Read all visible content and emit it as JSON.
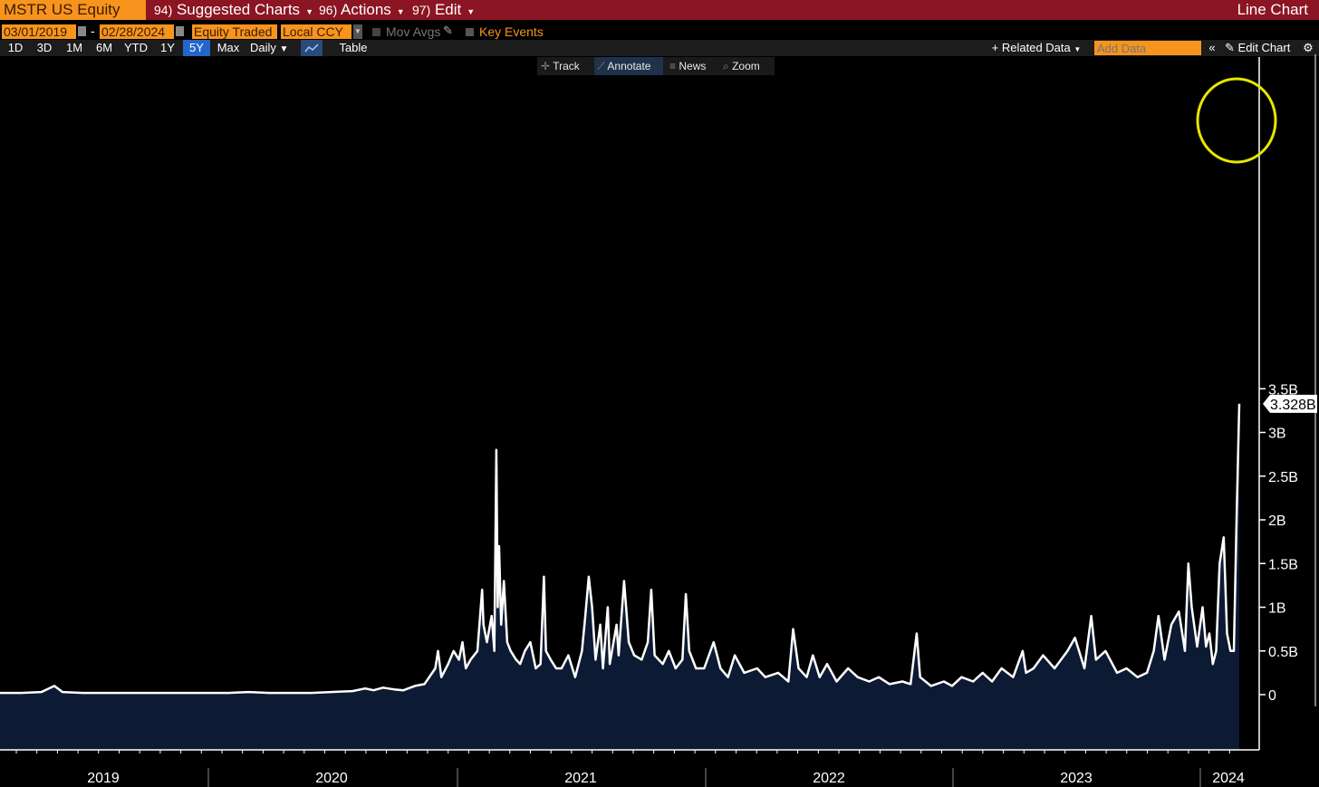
{
  "toolbar": {
    "ticker": "MSTR US Equity",
    "menu": [
      {
        "num": "94)",
        "label": "Suggested Charts"
      },
      {
        "num": "96)",
        "label": "Actions"
      },
      {
        "num": "97)",
        "label": "Edit"
      }
    ],
    "chart_kind": "Line Chart"
  },
  "range": {
    "start": "03/01/2019",
    "end": "02/28/2024",
    "field": "Equity Traded",
    "currency": "Local CCY",
    "mov_avgs": "Mov Avgs",
    "key_events": "Key Events"
  },
  "periods": [
    "1D",
    "3D",
    "1M",
    "6M",
    "YTD",
    "1Y",
    "5Y",
    "Max"
  ],
  "active_period": "5Y",
  "frequency": "Daily",
  "table_label": "Table",
  "related_data": "+ Related Data",
  "add_data_placeholder": "Add Data",
  "edit_chart": "Edit Chart",
  "annotations": [
    "Track",
    "Annotate",
    "News",
    "Zoom"
  ],
  "colors": {
    "line": "#ffffff",
    "fill": "#0c1a33",
    "highlight_circle": "#e6e600",
    "toolbar": "#8b1522",
    "accent": "#f7941d"
  },
  "chart_data": {
    "type": "area",
    "series": [
      {
        "name": "Equity Traded",
        "last_value_label": "3.328B"
      }
    ],
    "x_ticks": [
      "2019",
      "2020",
      "2021",
      "2022",
      "2023",
      "2024"
    ],
    "y_ticks": [
      "3.5B",
      "3B",
      "2.5B",
      "2B",
      "1.5B",
      "1B",
      "0.5B",
      "0"
    ],
    "ylim": [
      0,
      3500000000
    ],
    "x_start": "2019-03-01",
    "x_end": "2024-02-28",
    "points": [
      [
        "2019-03-01",
        0.02
      ],
      [
        "2019-04-01",
        0.02
      ],
      [
        "2019-05-01",
        0.03
      ],
      [
        "2019-05-20",
        0.1
      ],
      [
        "2019-06-01",
        0.03
      ],
      [
        "2019-07-01",
        0.02
      ],
      [
        "2019-08-01",
        0.02
      ],
      [
        "2019-09-01",
        0.02
      ],
      [
        "2019-10-01",
        0.02
      ],
      [
        "2019-11-01",
        0.02
      ],
      [
        "2019-12-01",
        0.02
      ],
      [
        "2020-01-01",
        0.02
      ],
      [
        "2020-02-01",
        0.02
      ],
      [
        "2020-03-01",
        0.03
      ],
      [
        "2020-04-01",
        0.02
      ],
      [
        "2020-05-01",
        0.02
      ],
      [
        "2020-06-01",
        0.02
      ],
      [
        "2020-07-01",
        0.03
      ],
      [
        "2020-08-01",
        0.04
      ],
      [
        "2020-08-20",
        0.07
      ],
      [
        "2020-09-01",
        0.05
      ],
      [
        "2020-09-15",
        0.08
      ],
      [
        "2020-10-01",
        0.06
      ],
      [
        "2020-10-15",
        0.05
      ],
      [
        "2020-11-01",
        0.1
      ],
      [
        "2020-11-15",
        0.12
      ],
      [
        "2020-12-01",
        0.3
      ],
      [
        "2020-12-05",
        0.5
      ],
      [
        "2020-12-10",
        0.2
      ],
      [
        "2020-12-20",
        0.35
      ],
      [
        "2020-12-28",
        0.5
      ],
      [
        "2021-01-05",
        0.4
      ],
      [
        "2021-01-10",
        0.6
      ],
      [
        "2021-01-15",
        0.3
      ],
      [
        "2021-01-22",
        0.4
      ],
      [
        "2021-02-01",
        0.5
      ],
      [
        "2021-02-08",
        1.2
      ],
      [
        "2021-02-10",
        0.8
      ],
      [
        "2021-02-15",
        0.6
      ],
      [
        "2021-02-22",
        0.9
      ],
      [
        "2021-02-26",
        0.5
      ],
      [
        "2021-03-01",
        2.8
      ],
      [
        "2021-03-03",
        1.0
      ],
      [
        "2021-03-05",
        1.7
      ],
      [
        "2021-03-08",
        0.8
      ],
      [
        "2021-03-12",
        1.3
      ],
      [
        "2021-03-17",
        0.6
      ],
      [
        "2021-03-22",
        0.5
      ],
      [
        "2021-03-30",
        0.4
      ],
      [
        "2021-04-05",
        0.35
      ],
      [
        "2021-04-12",
        0.5
      ],
      [
        "2021-04-20",
        0.6
      ],
      [
        "2021-04-28",
        0.3
      ],
      [
        "2021-05-05",
        0.35
      ],
      [
        "2021-05-10",
        1.35
      ],
      [
        "2021-05-13",
        0.5
      ],
      [
        "2021-05-20",
        0.4
      ],
      [
        "2021-05-28",
        0.3
      ],
      [
        "2021-06-05",
        0.3
      ],
      [
        "2021-06-15",
        0.45
      ],
      [
        "2021-06-25",
        0.2
      ],
      [
        "2021-07-05",
        0.5
      ],
      [
        "2021-07-10",
        0.9
      ],
      [
        "2021-07-15",
        1.35
      ],
      [
        "2021-07-20",
        1.0
      ],
      [
        "2021-07-25",
        0.4
      ],
      [
        "2021-08-01",
        0.8
      ],
      [
        "2021-08-05",
        0.3
      ],
      [
        "2021-08-12",
        1.0
      ],
      [
        "2021-08-15",
        0.35
      ],
      [
        "2021-08-25",
        0.8
      ],
      [
        "2021-08-28",
        0.45
      ],
      [
        "2021-09-05",
        1.3
      ],
      [
        "2021-09-12",
        0.6
      ],
      [
        "2021-09-20",
        0.45
      ],
      [
        "2021-10-01",
        0.4
      ],
      [
        "2021-10-10",
        0.6
      ],
      [
        "2021-10-15",
        1.2
      ],
      [
        "2021-10-20",
        0.45
      ],
      [
        "2021-11-01",
        0.35
      ],
      [
        "2021-11-10",
        0.5
      ],
      [
        "2021-11-20",
        0.3
      ],
      [
        "2021-11-30",
        0.4
      ],
      [
        "2021-12-05",
        1.15
      ],
      [
        "2021-12-10",
        0.5
      ],
      [
        "2021-12-20",
        0.3
      ],
      [
        "2022-01-01",
        0.3
      ],
      [
        "2022-01-15",
        0.6
      ],
      [
        "2022-01-25",
        0.3
      ],
      [
        "2022-02-05",
        0.2
      ],
      [
        "2022-02-15",
        0.45
      ],
      [
        "2022-03-01",
        0.25
      ],
      [
        "2022-03-20",
        0.3
      ],
      [
        "2022-04-01",
        0.2
      ],
      [
        "2022-04-20",
        0.25
      ],
      [
        "2022-05-05",
        0.15
      ],
      [
        "2022-05-12",
        0.75
      ],
      [
        "2022-05-20",
        0.3
      ],
      [
        "2022-06-01",
        0.2
      ],
      [
        "2022-06-10",
        0.45
      ],
      [
        "2022-06-20",
        0.2
      ],
      [
        "2022-07-01",
        0.35
      ],
      [
        "2022-07-15",
        0.15
      ],
      [
        "2022-08-01",
        0.3
      ],
      [
        "2022-08-15",
        0.2
      ],
      [
        "2022-09-01",
        0.15
      ],
      [
        "2022-09-15",
        0.2
      ],
      [
        "2022-10-01",
        0.12
      ],
      [
        "2022-10-20",
        0.15
      ],
      [
        "2022-11-01",
        0.12
      ],
      [
        "2022-11-10",
        0.7
      ],
      [
        "2022-11-15",
        0.2
      ],
      [
        "2022-12-01",
        0.1
      ],
      [
        "2022-12-20",
        0.15
      ],
      [
        "2023-01-01",
        0.1
      ],
      [
        "2023-01-15",
        0.2
      ],
      [
        "2023-02-01",
        0.15
      ],
      [
        "2023-02-15",
        0.25
      ],
      [
        "2023-03-01",
        0.15
      ],
      [
        "2023-03-15",
        0.3
      ],
      [
        "2023-04-01",
        0.2
      ],
      [
        "2023-04-15",
        0.5
      ],
      [
        "2023-04-20",
        0.25
      ],
      [
        "2023-05-01",
        0.3
      ],
      [
        "2023-05-15",
        0.45
      ],
      [
        "2023-06-01",
        0.3
      ],
      [
        "2023-06-20",
        0.5
      ],
      [
        "2023-07-01",
        0.65
      ],
      [
        "2023-07-15",
        0.3
      ],
      [
        "2023-07-25",
        0.9
      ],
      [
        "2023-08-01",
        0.4
      ],
      [
        "2023-08-15",
        0.5
      ],
      [
        "2023-09-01",
        0.25
      ],
      [
        "2023-09-15",
        0.3
      ],
      [
        "2023-10-01",
        0.2
      ],
      [
        "2023-10-15",
        0.25
      ],
      [
        "2023-10-25",
        0.5
      ],
      [
        "2023-11-01",
        0.9
      ],
      [
        "2023-11-10",
        0.4
      ],
      [
        "2023-11-20",
        0.8
      ],
      [
        "2023-12-01",
        0.95
      ],
      [
        "2023-12-10",
        0.5
      ],
      [
        "2023-12-15",
        1.5
      ],
      [
        "2023-12-20",
        1.0
      ],
      [
        "2023-12-28",
        0.55
      ],
      [
        "2024-01-05",
        1.0
      ],
      [
        "2024-01-10",
        0.55
      ],
      [
        "2024-01-15",
        0.7
      ],
      [
        "2024-01-20",
        0.35
      ],
      [
        "2024-01-25",
        0.5
      ],
      [
        "2024-01-30",
        1.5
      ],
      [
        "2024-02-05",
        1.8
      ],
      [
        "2024-02-10",
        0.7
      ],
      [
        "2024-02-15",
        0.5
      ],
      [
        "2024-02-20",
        0.5
      ],
      [
        "2024-02-24",
        2.0
      ],
      [
        "2024-02-28",
        3.328
      ]
    ]
  }
}
